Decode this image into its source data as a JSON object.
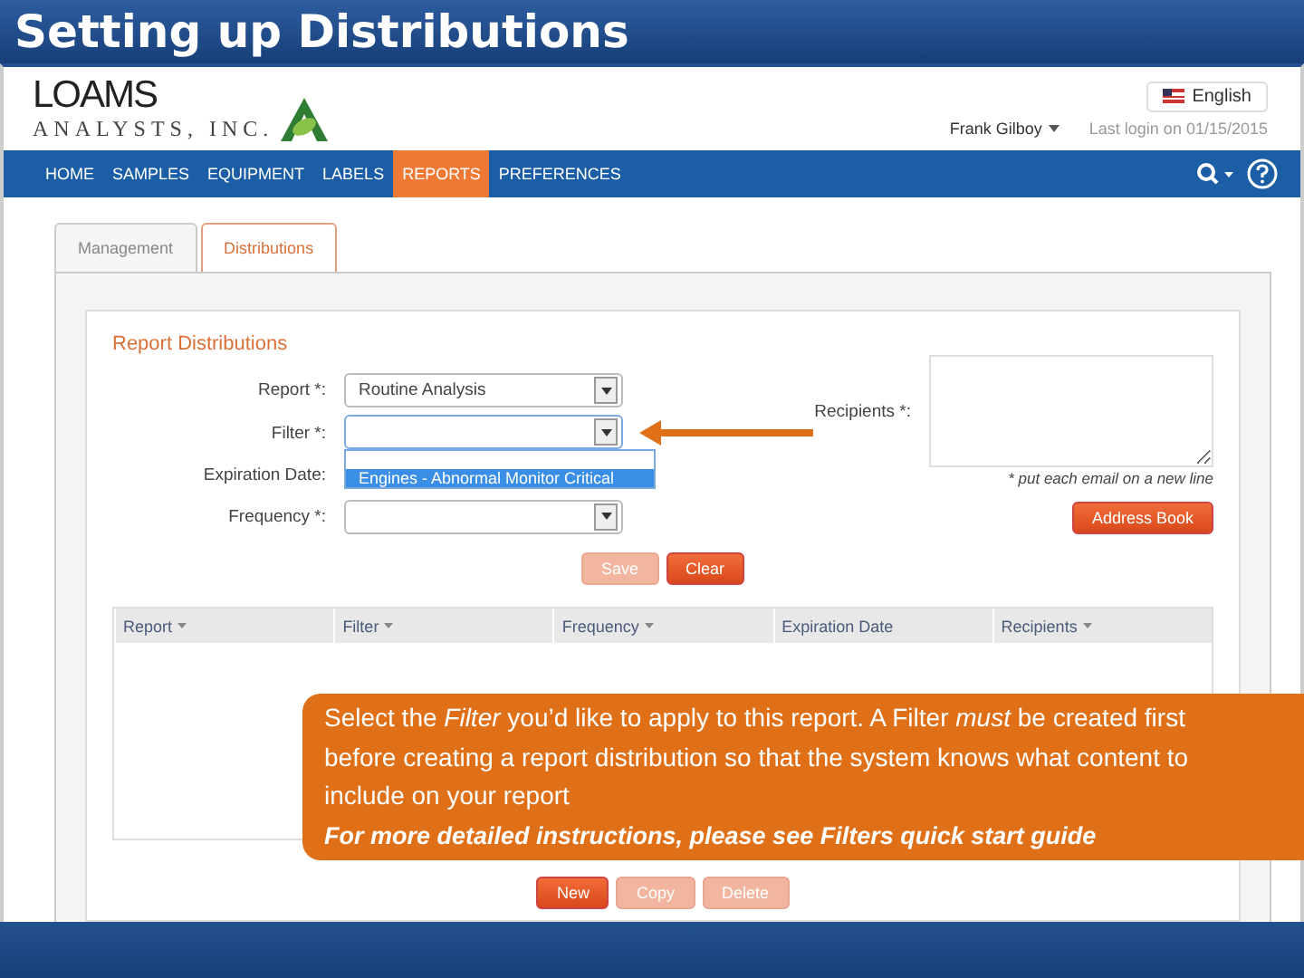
{
  "slide_title": "Setting up Distributions",
  "header": {
    "logo_line1": "LOAMS",
    "logo_line2": "ANALYSTS, INC.",
    "language": "English",
    "user": "Frank Gilboy",
    "last_login": "Last login on 01/15/2015"
  },
  "nav": [
    {
      "label": "HOME",
      "selected": false
    },
    {
      "label": "SAMPLES",
      "selected": false
    },
    {
      "label": "EQUIPMENT",
      "selected": false
    },
    {
      "label": "LABELS",
      "selected": false
    },
    {
      "label": "REPORTS",
      "selected": true
    },
    {
      "label": "PREFERENCES",
      "selected": false
    }
  ],
  "tabs": [
    {
      "label": "Management",
      "selected": false
    },
    {
      "label": "Distributions",
      "selected": true
    }
  ],
  "form": {
    "title": "Report Distributions",
    "fields": [
      {
        "label": "Report *:",
        "kind": "select",
        "value": "Routine Analysis"
      },
      {
        "label": "Filter *:",
        "kind": "select",
        "open": true,
        "options": [
          {
            "label": "Engines - Abnormal Monitor Critical",
            "selected": true
          }
        ]
      },
      {
        "label": "Expiration Date:",
        "kind": "hidden"
      },
      {
        "label": "Frequency *:",
        "kind": "select"
      }
    ],
    "recipients_label": "Recipients *:",
    "recipients_note": "* put each email on a new line",
    "address_book": "Address Book",
    "buttons": [
      {
        "label": "Save",
        "disabled": true
      },
      {
        "label": "Clear",
        "disabled": false
      }
    ]
  },
  "table": {
    "columns": [
      {
        "label": "Report",
        "sortable": true
      },
      {
        "label": "Filter",
        "sortable": true
      },
      {
        "label": "Frequency",
        "sortable": true
      },
      {
        "label": "Expiration Date",
        "sortable": false
      },
      {
        "label": "Recipients",
        "sortable": true
      }
    ],
    "buttons": [
      {
        "label": "New",
        "disabled": false
      },
      {
        "label": "Copy",
        "disabled": true
      },
      {
        "label": "Delete",
        "disabled": true
      }
    ]
  },
  "callout": {
    "text": "Select the *Filter* you’d like to apply to this report.  A Filter *must* be created first before creating a report distribution so that the system knows what content to include on your report",
    "note": "For more detailed instructions, please see Filters quick start guide"
  }
}
